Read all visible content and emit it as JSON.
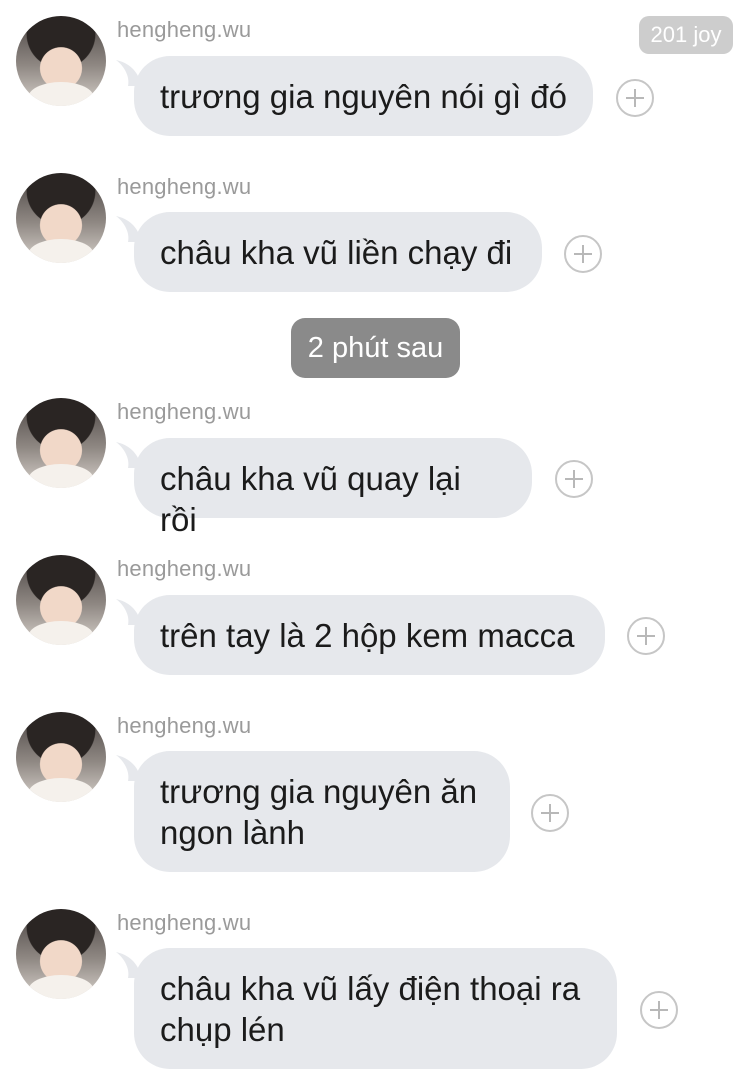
{
  "badge": "201 joy",
  "timestamp": "2 phút sau",
  "messages": [
    {
      "username": "hengheng.wu",
      "text": "trương gia nguyên nói gì đó"
    },
    {
      "username": "hengheng.wu",
      "text": "châu kha vũ liền chạy đi"
    },
    {
      "username": "hengheng.wu",
      "text": "châu kha vũ quay lại rồi"
    },
    {
      "username": "hengheng.wu",
      "text": "trên tay là 2 hộp kem macca"
    },
    {
      "username": "hengheng.wu",
      "text": "trương gia nguyên ăn\nngon lành"
    },
    {
      "username": "hengheng.wu",
      "text": "châu kha vũ lấy điện thoại ra\nchụp lén"
    }
  ]
}
